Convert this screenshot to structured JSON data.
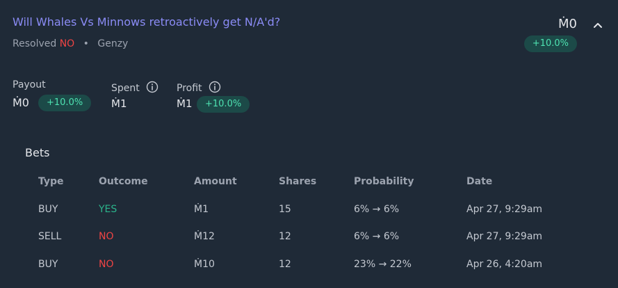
{
  "market": {
    "title": "Will Whales Vs Minnows retroactively get N/A'd?",
    "resolved_prefix": "Resolved",
    "resolution": "NO",
    "separator": "•",
    "creator": "Genzy",
    "amount": "Ṁ0",
    "change": "+10.0%"
  },
  "stats": {
    "payout_label": "Payout",
    "payout_value": "Ṁ0",
    "payout_change": "+10.0%",
    "spent_label": "Spent",
    "spent_value": "Ṁ1",
    "profit_label": "Profit",
    "profit_value": "Ṁ1",
    "profit_change": "+10.0%"
  },
  "bets": {
    "title": "Bets",
    "headers": [
      "Type",
      "Outcome",
      "Amount",
      "Shares",
      "Probability",
      "Date"
    ],
    "rows": [
      {
        "type": "BUY",
        "outcome": "YES",
        "amount": "Ṁ1",
        "shares": "15",
        "probability": "6% → 6%",
        "date": "Apr 27, 9:29am"
      },
      {
        "type": "SELL",
        "outcome": "NO",
        "amount": "Ṁ12",
        "shares": "12",
        "probability": "6% → 6%",
        "date": "Apr 27, 9:29am"
      },
      {
        "type": "BUY",
        "outcome": "NO",
        "amount": "Ṁ10",
        "shares": "12",
        "probability": "23% → 22%",
        "date": "Apr 26, 4:20am"
      }
    ]
  },
  "colors": {
    "background": "#1f2a37",
    "title": "#8b8cf6",
    "no": "#ef4444",
    "yes": "#2bb48b",
    "pill_bg": "#1c4a48",
    "pill_text": "#4ee2b1"
  },
  "icons": {
    "collapse": "chevron-up-icon",
    "info": "info-circle-icon"
  }
}
